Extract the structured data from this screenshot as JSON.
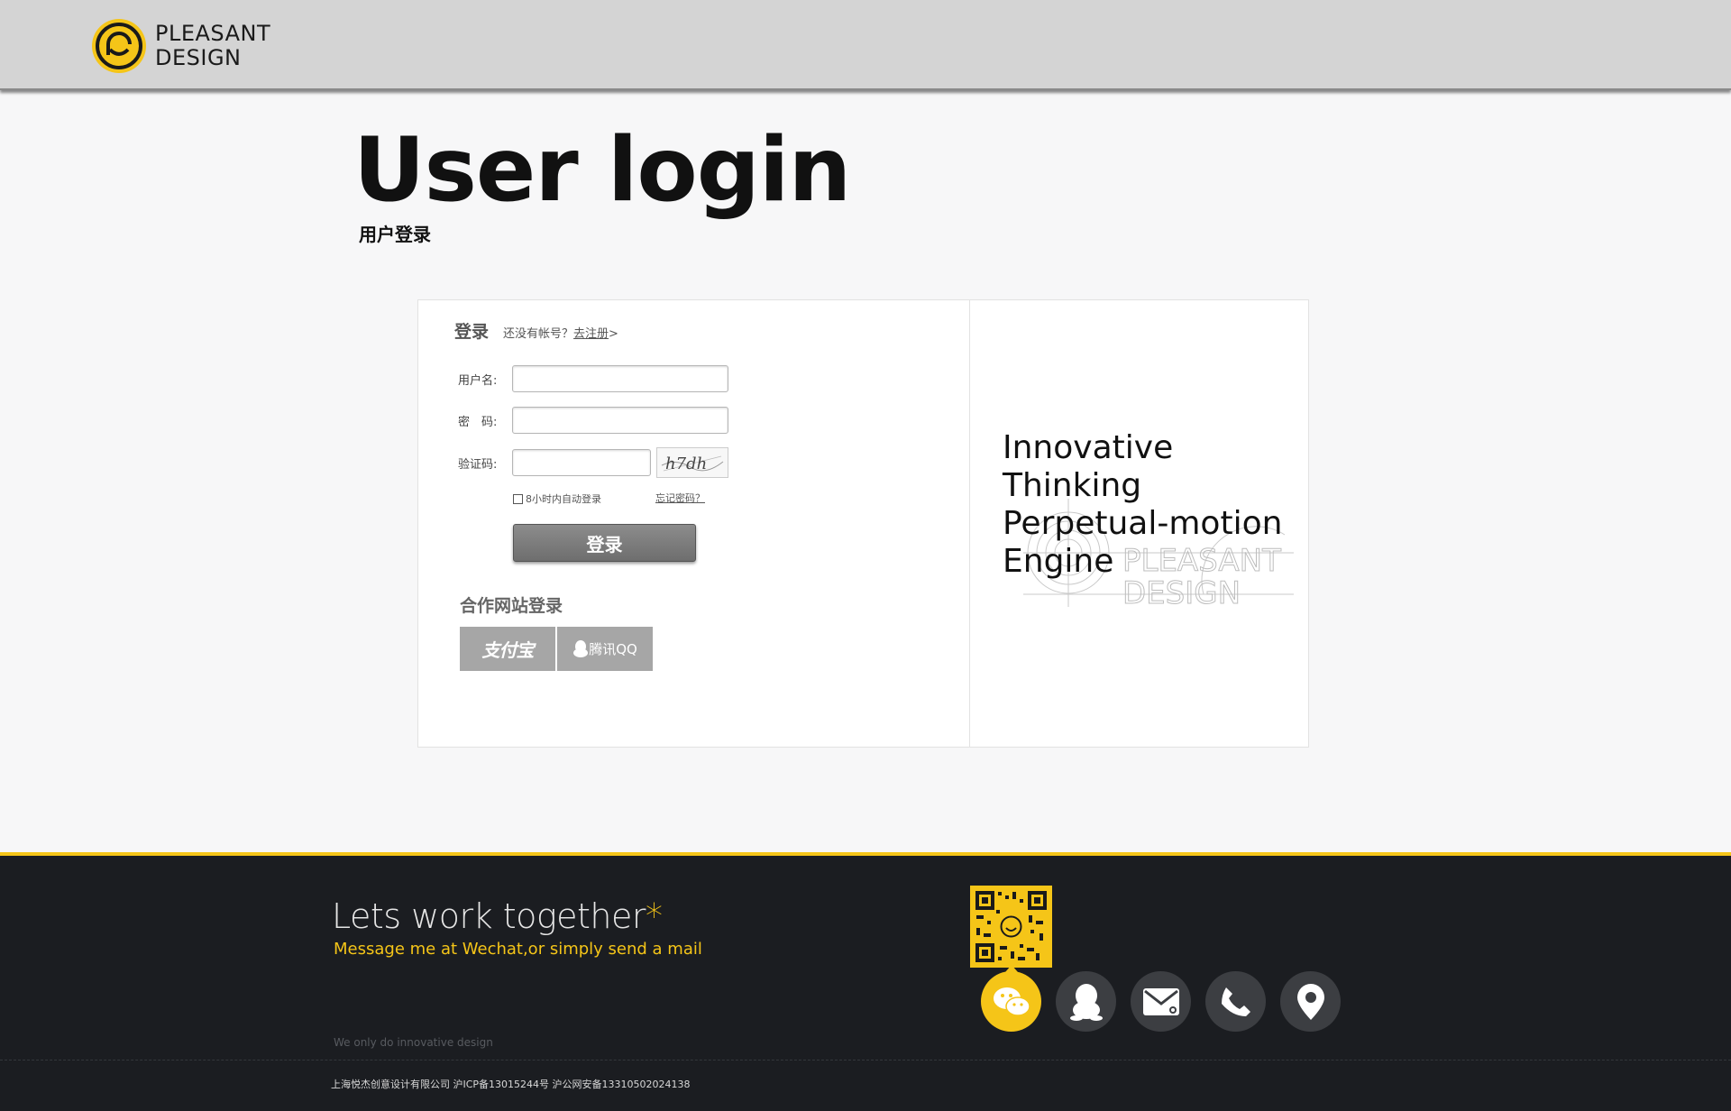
{
  "header": {
    "logo_line1": "PLEASANT",
    "logo_line2": "DESIGN"
  },
  "page": {
    "title": "User login",
    "subtitle": "用户登录"
  },
  "login": {
    "title": "登录",
    "no_account": "还没有帐号？",
    "register_link": "去注册",
    "register_arrow": ">",
    "username_label": "用户名:",
    "password_label": "密　码:",
    "captcha_label": "验证码:",
    "captcha_text": "h7dh",
    "remember_label": "8小时内自动登录",
    "forgot_link": "忘记密码？",
    "submit_label": "登录",
    "partner_title": "合作网站登录",
    "partner_alipay": "支付宝",
    "partner_qq": "腾讯QQ"
  },
  "promo": {
    "line1": "Innovative",
    "line2": "Thinking",
    "line3": "Perpetual-motion",
    "line4": "Engine",
    "watermark_line1": "PLEASANT",
    "watermark_line2": "DESIGN"
  },
  "footer": {
    "title": "Lets work together",
    "title_star": "*",
    "subtitle": "Message me at Wechat,or simply send a mail",
    "tagline": "We only do innovative design",
    "copyright": "上海悦杰创意设计有限公司  沪ICP备13015244号  沪公网安备13310502024138"
  },
  "social_icons": [
    "wechat-icon",
    "qq-icon",
    "mail-icon",
    "phone-icon",
    "location-icon"
  ],
  "colors": {
    "accent": "#f5c518",
    "footer_bg": "#1b1d21",
    "header_bg": "#d4d4d4",
    "button_bg": "#7a7a7a"
  }
}
